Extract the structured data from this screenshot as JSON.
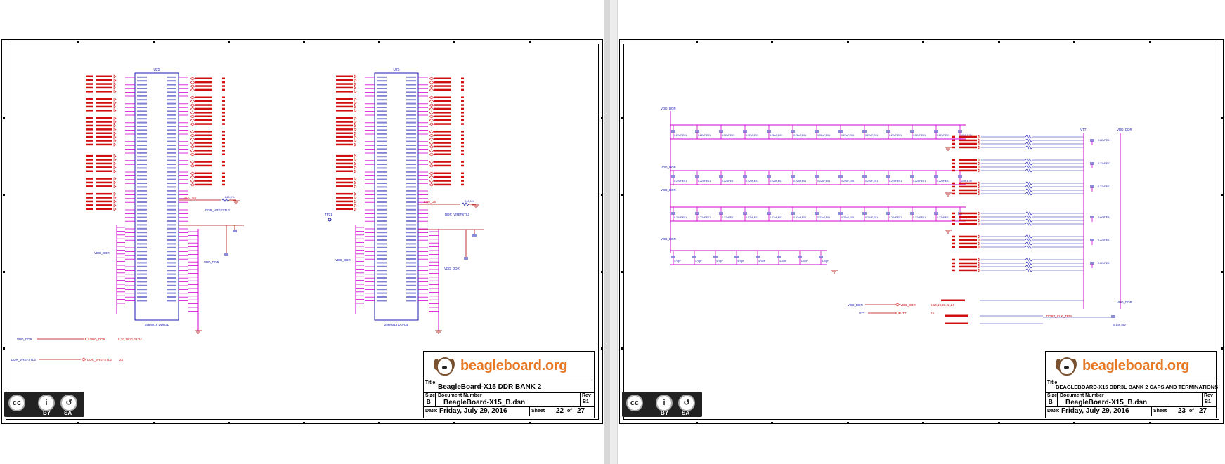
{
  "sheets": [
    {
      "logo": "beagleboard.org",
      "title_label": "Title",
      "title": "BeagleBoard-X15 DDR BANK 2",
      "size_label": "Size",
      "size": "B",
      "docnum_label": "Document Number",
      "docnum": "BeagleBoard-X15_B.dsn",
      "rev_label": "Rev",
      "rev": "B1",
      "date_label": "Date:",
      "date": "Friday, July 29, 2016",
      "sheet_label": "Sheet",
      "sheet": "22",
      "of_label": "of",
      "total": "27",
      "chips": [
        {
          "ref": "U25",
          "part": "256Mx16 DDR3L"
        },
        {
          "ref": "U26",
          "part": "256Mx16 DDR3L"
        }
      ],
      "net_labels": {
        "vdd": "VDD_DDR",
        "vref": "DDR_VREFSTL2",
        "vref_res": "240,1%",
        "zq": "ZQ0_U5",
        "vref_page": "24",
        "vdd_pages": "5,10,19,21,23,24",
        "tp": "TP21"
      },
      "cc": {
        "by": "BY",
        "sa": "SA"
      }
    },
    {
      "logo": "beagleboard.org",
      "title_label": "Title",
      "title": "BEAGLEBOARD-X15 DDR3L BANK 2 CAPS AND TERMINATIONS",
      "size_label": "Size",
      "size": "B",
      "docnum_label": "Document Number",
      "docnum": "BeagleBoard-X15_B.dsn",
      "rev_label": "Rev",
      "rev": "B1",
      "date_label": "Date:",
      "date": "Friday, July 29, 2016",
      "sheet_label": "Sheet",
      "sheet": "23",
      "of_label": "of",
      "total": "27",
      "net_labels": {
        "vdd": "VDD_DDR",
        "vtt": "VTT",
        "cap": "0.22uF,E01",
        "bulk": "10uF,6.3V",
        "small": "470pF",
        "vdd_pages": "5,10,19,21,22,24",
        "vtt_page": "24",
        "clk_trm": "DDR2_CLK_TRM",
        "cap_trm": "0.1uF,16V"
      },
      "cc": {
        "by": "BY",
        "sa": "SA"
      }
    }
  ],
  "colors": {
    "net": "#d01010",
    "part": "#1a1ab0",
    "pin": "#d000d0",
    "wire": "#b00000",
    "logo": "#e87722"
  }
}
